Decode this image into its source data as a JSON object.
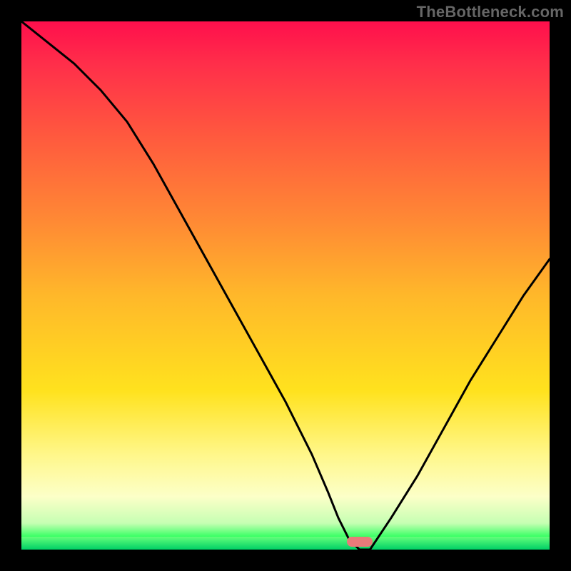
{
  "watermark": "TheBottleneck.com",
  "colors": {
    "curve": "#000000",
    "marker": "#e87a7a",
    "background_black": "#000000"
  },
  "chart_data": {
    "type": "line",
    "title": "",
    "xlabel": "",
    "ylabel": "",
    "xlim": [
      0,
      100
    ],
    "ylim": [
      0,
      100
    ],
    "note": "Bottleneck-style curve: y ≈ distance from optimum (x≈64). Descends from 100 at x=0 to 0 near x=64, then rises toward ~55 at x=100.",
    "marker_x": 64,
    "series": [
      {
        "name": "bottleneck_curve",
        "x": [
          0,
          5,
          10,
          15,
          20,
          25,
          30,
          35,
          40,
          45,
          50,
          55,
          58,
          60,
          62,
          64,
          66,
          70,
          75,
          80,
          85,
          90,
          95,
          100
        ],
        "y": [
          100,
          96,
          92,
          87,
          81,
          73,
          64,
          55,
          46,
          37,
          28,
          18,
          11,
          6,
          2,
          0,
          0,
          6,
          14,
          23,
          32,
          40,
          48,
          55
        ]
      }
    ],
    "gradient_stops": [
      {
        "pct": 0,
        "color": "#ff0f4c"
      },
      {
        "pct": 22,
        "color": "#ff5a3e"
      },
      {
        "pct": 52,
        "color": "#ffb82a"
      },
      {
        "pct": 82,
        "color": "#fff78a"
      },
      {
        "pct": 95,
        "color": "#c6ffb3"
      },
      {
        "pct": 100,
        "color": "#00d36a"
      }
    ]
  }
}
